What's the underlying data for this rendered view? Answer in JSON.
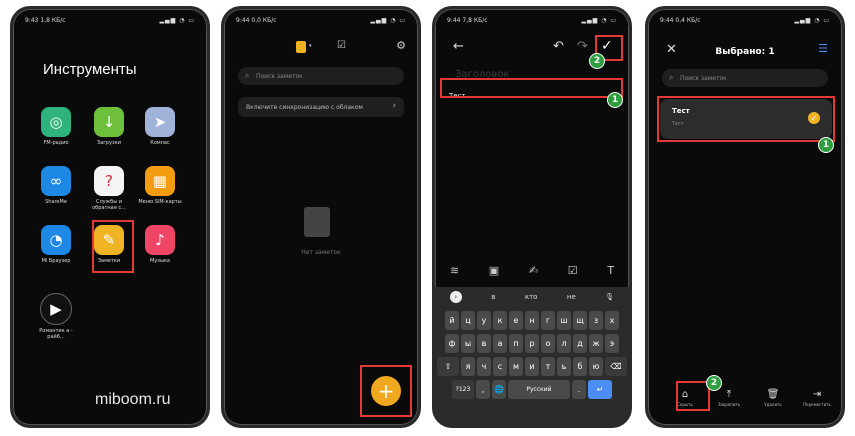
{
  "phone1": {
    "status": {
      "time": "9:43",
      "speed": "1,8 КБ/с"
    },
    "folder_title": "Инструменты",
    "apps": [
      {
        "label": "FM-радио",
        "color": "#2db37b",
        "glyph": "◎"
      },
      {
        "label": "Загрузки",
        "color": "#6dbf3c",
        "glyph": "↓"
      },
      {
        "label": "Компас",
        "color": "#9fb3d9",
        "glyph": "➤"
      },
      {
        "label": "ShareMe",
        "color": "#1e88e5",
        "glyph": "∞"
      },
      {
        "label": "Службы и обратная с...",
        "color": "#f4f4f4",
        "glyph": "?"
      },
      {
        "label": "Меню SIM-карты",
        "color": "#f39c12",
        "glyph": "▦"
      },
      {
        "label": "Mi Браузер",
        "color": "#1e88e5",
        "glyph": "◔"
      },
      {
        "label": "Заметки",
        "color": "#f0b323",
        "glyph": "✎"
      },
      {
        "label": "Музыка",
        "color": "#ef4665",
        "glyph": "♪"
      },
      {
        "label": "Романтик а - рай6...",
        "color": "#222222",
        "glyph": "▶"
      }
    ],
    "watermark": "miboom.ru"
  },
  "phone2": {
    "status": {
      "time": "9:44",
      "speed": "0,0 КБ/с"
    },
    "search_placeholder": "Поиск заметок",
    "sync_text": "Включите синхронизацию с облаком",
    "empty_text": "Нет заметок",
    "fab_label": "+"
  },
  "phone3": {
    "status": {
      "time": "9:44",
      "speed": "7,8 КБ/с"
    },
    "title_placeholder": "Заголовок",
    "note_text": "Тест",
    "badge1": "1",
    "badge2": "2",
    "suggestions": [
      "в",
      "кто",
      "не"
    ],
    "keyboard": {
      "row1": [
        "й",
        "ц",
        "у",
        "к",
        "е",
        "н",
        "г",
        "ш",
        "щ",
        "з",
        "х"
      ],
      "row2": [
        "ф",
        "ы",
        "в",
        "а",
        "п",
        "р",
        "о",
        "л",
        "д",
        "ж",
        "э"
      ],
      "row3": [
        "я",
        "ч",
        "с",
        "м",
        "и",
        "т",
        "ь",
        "б",
        "ю"
      ],
      "numbers": "?123",
      "comma": ",",
      "space": "Русский",
      "period": "."
    }
  },
  "phone4": {
    "status": {
      "time": "9:44",
      "speed": "0,4 КБ/с"
    },
    "title": "Выбрано: 1",
    "search_placeholder": "Поиск заметок",
    "card_title": "Тест",
    "card_sub": "Тест",
    "badge1": "1",
    "badge2": "2",
    "actions": [
      {
        "label": "Скрыть",
        "glyph": "⌂"
      },
      {
        "label": "Закрепить",
        "glyph": "⤒"
      },
      {
        "label": "Удалить",
        "glyph": "🗑"
      },
      {
        "label": "Переместить",
        "glyph": "⇥"
      }
    ]
  }
}
